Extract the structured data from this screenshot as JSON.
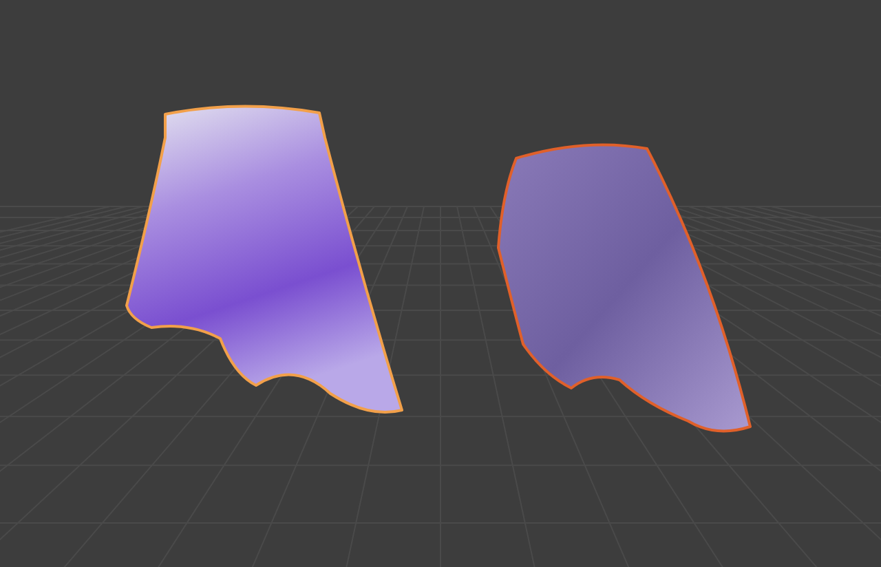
{
  "viewport": {
    "objects": [
      {
        "kind": "skirt",
        "selected": true,
        "active": true
      },
      {
        "kind": "skirt",
        "selected": true,
        "active": false
      }
    ]
  }
}
